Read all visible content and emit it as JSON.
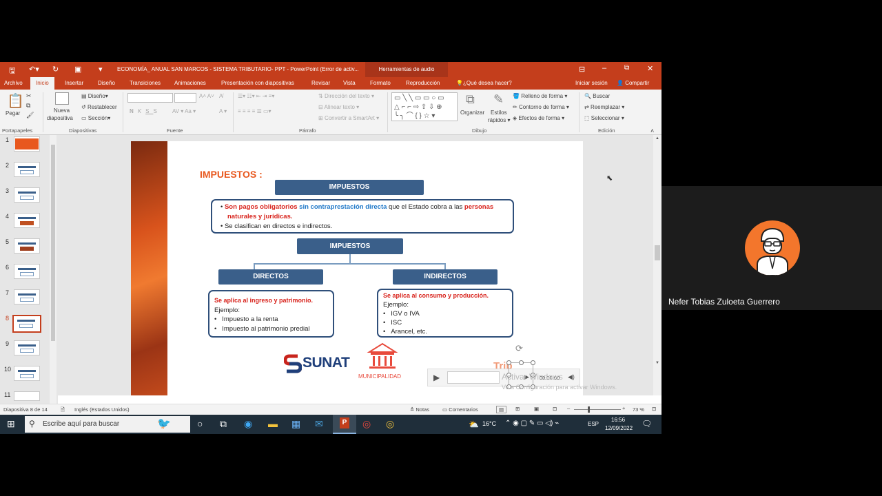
{
  "titlebar": {
    "doc_title": "ECONOMÍA_ ANUAL SAN MARCOS - SISTEMA TRIBUTARIO- PPT - PowerPoint (Error de activ...",
    "context_tab": "Herramientas de audio",
    "tell_me": "¿Qué desea hacer?"
  },
  "menu": {
    "tabs": [
      "Archivo",
      "Inicio",
      "Insertar",
      "Diseño",
      "Transiciones",
      "Animaciones",
      "Presentación con diapositivas",
      "Revisar",
      "Vista",
      "Formato",
      "Reproducción"
    ],
    "signin": "Iniciar sesión",
    "share": "Compartir"
  },
  "ribbon": {
    "paste": "Pegar",
    "new_slide_1": "Nueva",
    "new_slide_2": "diapositiva",
    "design": "Diseño",
    "reset": "Restablecer",
    "section": "Sección",
    "text_direction": "Dirección del texto",
    "align_text": "Alinear texto",
    "smartart": "Convertir a SmartArt",
    "arrange": "Organizar",
    "quick_styles_1": "Estilos",
    "quick_styles_2": "rápidos",
    "shape_fill": "Relleno de forma",
    "shape_outline": "Contorno de forma",
    "shape_effects": "Efectos de forma",
    "find": "Buscar",
    "replace": "Reemplazar",
    "select": "Seleccionar",
    "groups": {
      "clipboard": "Portapapeles",
      "slides": "Diapositivas",
      "font": "Fuente",
      "paragraph": "Párrafo",
      "drawing": "Dibujo",
      "editing": "Edición"
    }
  },
  "thumbnails": [
    "1",
    "2",
    "3",
    "4",
    "5",
    "6",
    "7",
    "8",
    "9",
    "10",
    "11"
  ],
  "slide": {
    "heading": "IMPUESTOS :",
    "top_box": "IMPUESTOS",
    "def_part1": "Son pagos obligatorios",
    "def_part2": "sin contraprestación directa",
    "def_part3": "que el Estado cobra a las",
    "def_part4": "personas naturales y jurídicas",
    "def_part5": ".",
    "def_bullet2": "Se clasifican en directos e indirectos.",
    "mid_box": "IMPUESTOS",
    "directos": "DIRECTOS",
    "indirectos": "INDIRECTOS",
    "dir_title": "Se aplica al ingreso y patrimonio.",
    "dir_example": "Ejemplo:",
    "dir_items": [
      "Impuesto a la renta",
      "Impuesto al patrimonio predial"
    ],
    "ind_title": "Se aplica al consumo y producción.",
    "ind_example": "Ejemplo:",
    "ind_items": [
      "IGV o IVA",
      "ISC",
      "Arancel, etc."
    ],
    "sunat": "SUNAT",
    "municipalidad": "MUNICIPALIDAD",
    "audio_time": "00:00.00",
    "watermark_1": "Activar Windows",
    "watermark_2": "Ve a Configuración para activar Windows."
  },
  "status": {
    "slide_info": "Diapositiva 8 de 14",
    "language": "Inglés (Estados Unidos)",
    "notes": "Notas",
    "comments": "Comentarios",
    "zoom": "73 %"
  },
  "taskbar": {
    "search_placeholder": "Escribe aquí para buscar",
    "temp": "16°C",
    "lang": "ESP",
    "time": "16:56",
    "date": "12/09/2022"
  },
  "participant": {
    "name": "Nefer Tobias Zuloeta Guerrero"
  },
  "colors": {
    "ppt_red": "#c43e1c",
    "navy": "#3a5f8a",
    "accent_red": "#d8231c",
    "accent_blue": "#1f78c8"
  }
}
